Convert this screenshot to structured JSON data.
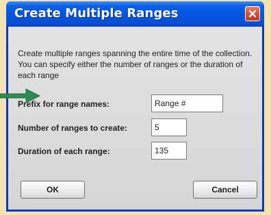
{
  "dialog": {
    "title": "Create Multiple Ranges",
    "description": "Create multiple ranges spanning the entire time of the collection. You can specify either the number of ranges or the duration of each range"
  },
  "form": {
    "prefix_label": "Prefix for range names:",
    "prefix_value": "Range #",
    "count_label": "Number of ranges to create:",
    "count_value": "5",
    "duration_label": "Duration of each range:",
    "duration_value": "135"
  },
  "buttons": {
    "ok_label": "OK",
    "cancel_label": "Cancel"
  },
  "colors": {
    "titlebar": "#0555e0",
    "close_button": "#d9502b",
    "arrow": "#2e8b57",
    "page_background": "#f5e3b3"
  },
  "icons": {
    "close": "close-icon",
    "annotation_arrow": "arrow-right-icon"
  }
}
